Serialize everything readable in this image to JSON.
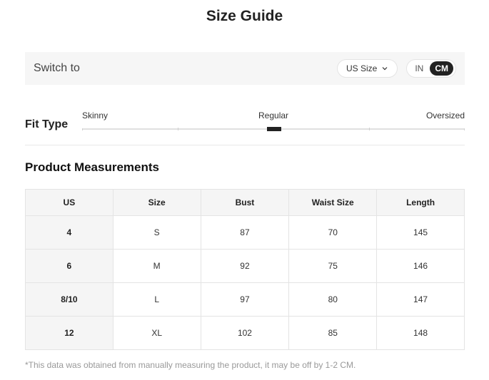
{
  "title": "Size Guide",
  "switch": {
    "label": "Switch to",
    "size_system": "US Size",
    "units": [
      "IN",
      "CM"
    ],
    "active_unit": "CM"
  },
  "fit": {
    "label": "Fit Type",
    "options": [
      "Skinny",
      "Regular",
      "Oversized"
    ],
    "selected": "Regular"
  },
  "measurements": {
    "title": "Product Measurements",
    "headers": [
      "US",
      "Size",
      "Bust",
      "Waist Size",
      "Length"
    ],
    "rows": [
      [
        "4",
        "S",
        "87",
        "70",
        "145"
      ],
      [
        "6",
        "M",
        "92",
        "75",
        "146"
      ],
      [
        "8/10",
        "L",
        "97",
        "80",
        "147"
      ],
      [
        "12",
        "XL",
        "102",
        "85",
        "148"
      ]
    ]
  },
  "footnote": "*This data was obtained from manually measuring the product, it may be off by 1-2 CM.",
  "colors": {
    "accent": "#222222",
    "panel": "#f6f6f6",
    "border": "#e4e4e4"
  }
}
